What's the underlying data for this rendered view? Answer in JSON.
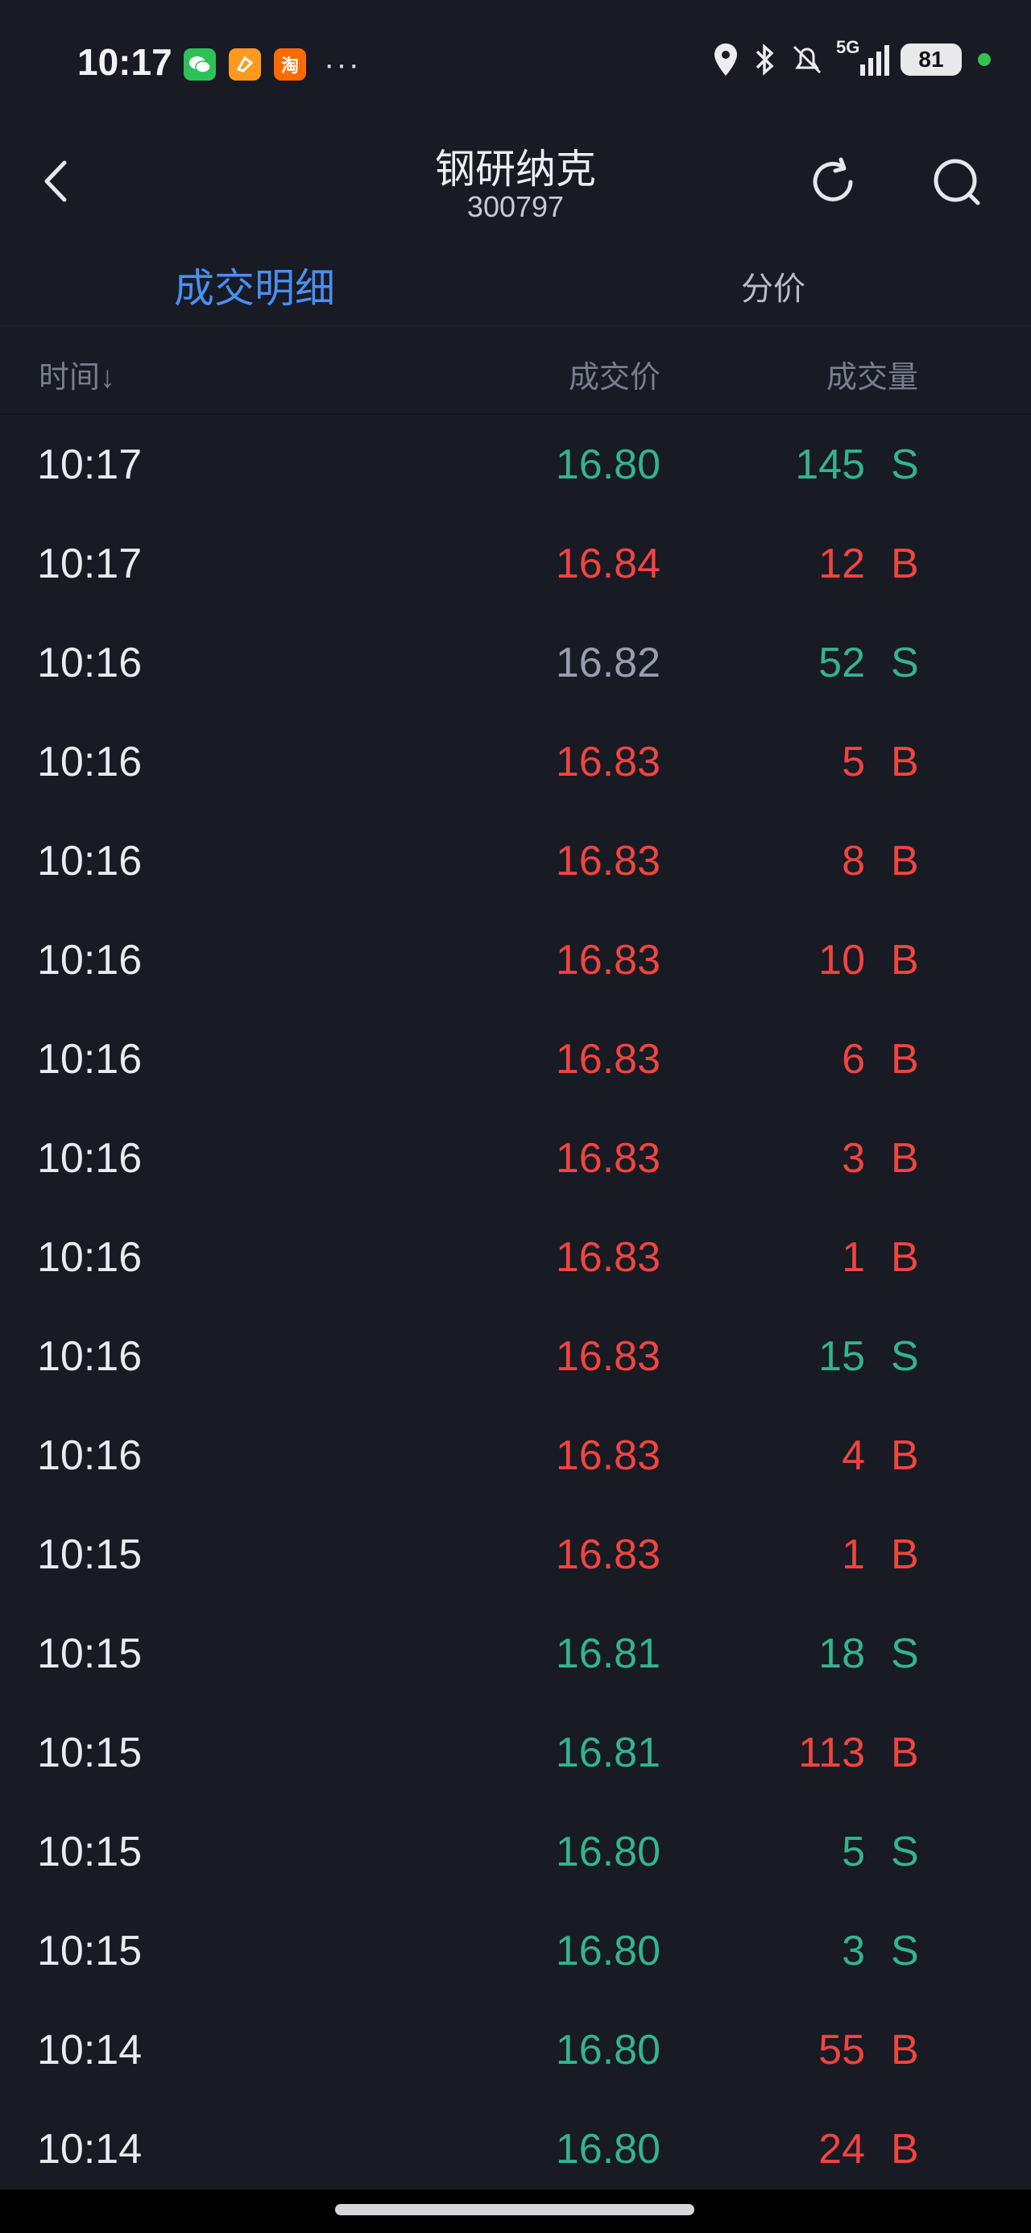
{
  "status_bar": {
    "time": "10:17",
    "taobao_glyph": "淘",
    "more": "···",
    "network": "5G",
    "battery": "81",
    "icons": [
      "wechat-icon",
      "orange-app-icon",
      "taobao-icon",
      "location-icon",
      "bluetooth-icon",
      "silent-icon",
      "signal-icon",
      "battery-icon"
    ]
  },
  "header": {
    "title": "钢研纳克",
    "code": "300797"
  },
  "tabs": [
    {
      "label": "成交明细",
      "active": true
    },
    {
      "label": "分价",
      "active": false
    }
  ],
  "table": {
    "columns": [
      "时间↓",
      "成交价",
      "成交量"
    ],
    "rows": [
      {
        "time": "10:17",
        "price": "16.80",
        "volume": "145",
        "side": "S",
        "price_color": "green",
        "vol_color": "green"
      },
      {
        "time": "10:17",
        "price": "16.84",
        "volume": "12",
        "side": "B",
        "price_color": "red",
        "vol_color": "red"
      },
      {
        "time": "10:16",
        "price": "16.82",
        "volume": "52",
        "side": "S",
        "price_color": "gray",
        "vol_color": "green"
      },
      {
        "time": "10:16",
        "price": "16.83",
        "volume": "5",
        "side": "B",
        "price_color": "red",
        "vol_color": "red"
      },
      {
        "time": "10:16",
        "price": "16.83",
        "volume": "8",
        "side": "B",
        "price_color": "red",
        "vol_color": "red"
      },
      {
        "time": "10:16",
        "price": "16.83",
        "volume": "10",
        "side": "B",
        "price_color": "red",
        "vol_color": "red"
      },
      {
        "time": "10:16",
        "price": "16.83",
        "volume": "6",
        "side": "B",
        "price_color": "red",
        "vol_color": "red"
      },
      {
        "time": "10:16",
        "price": "16.83",
        "volume": "3",
        "side": "B",
        "price_color": "red",
        "vol_color": "red"
      },
      {
        "time": "10:16",
        "price": "16.83",
        "volume": "1",
        "side": "B",
        "price_color": "red",
        "vol_color": "red"
      },
      {
        "time": "10:16",
        "price": "16.83",
        "volume": "15",
        "side": "S",
        "price_color": "red",
        "vol_color": "green"
      },
      {
        "time": "10:16",
        "price": "16.83",
        "volume": "4",
        "side": "B",
        "price_color": "red",
        "vol_color": "red"
      },
      {
        "time": "10:15",
        "price": "16.83",
        "volume": "1",
        "side": "B",
        "price_color": "red",
        "vol_color": "red"
      },
      {
        "time": "10:15",
        "price": "16.81",
        "volume": "18",
        "side": "S",
        "price_color": "green",
        "vol_color": "green"
      },
      {
        "time": "10:15",
        "price": "16.81",
        "volume": "113",
        "side": "B",
        "price_color": "green",
        "vol_color": "red"
      },
      {
        "time": "10:15",
        "price": "16.80",
        "volume": "5",
        "side": "S",
        "price_color": "green",
        "vol_color": "green"
      },
      {
        "time": "10:15",
        "price": "16.80",
        "volume": "3",
        "side": "S",
        "price_color": "green",
        "vol_color": "green"
      },
      {
        "time": "10:14",
        "price": "16.80",
        "volume": "55",
        "side": "B",
        "price_color": "green",
        "vol_color": "red"
      },
      {
        "time": "10:14",
        "price": "16.80",
        "volume": "24",
        "side": "B",
        "price_color": "green",
        "vol_color": "red"
      }
    ]
  },
  "colors": {
    "background": "#181a24",
    "accent": "#4a8ff2",
    "up_red": "#f2443f",
    "down_green": "#33b48e",
    "neutral_gray": "#9a9dab"
  }
}
